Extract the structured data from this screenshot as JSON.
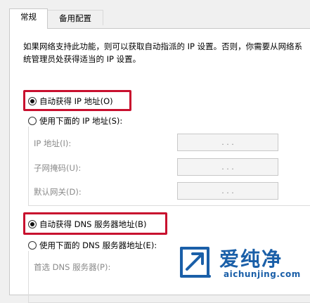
{
  "tabs": [
    {
      "label": "常规",
      "active": true
    },
    {
      "label": "备用配置",
      "active": false
    }
  ],
  "description": "如果网络支持此功能，则可以获取自动指派的 IP 设置。否则，你需要从网络系统管理员处获得适当的 IP 设置。",
  "ip": {
    "auto_label": "自动获得 IP 地址(O)",
    "auto_selected": true,
    "manual_label": "使用下面的 IP 地址(S):",
    "manual_selected": false,
    "fields": [
      {
        "label": "IP 地址(I):",
        "value": ". . ."
      },
      {
        "label": "子网掩码(U):",
        "value": ". . ."
      },
      {
        "label": "默认网关(D):",
        "value": ". . ."
      }
    ]
  },
  "dns": {
    "auto_label": "自动获得 DNS 服务器地址(B)",
    "auto_selected": true,
    "manual_label": "使用下面的 DNS 服务器地址(E):",
    "manual_selected": false,
    "fields": [
      {
        "label": "首选 DNS 服务器(P):"
      }
    ]
  },
  "watermark": {
    "name": "爱纯净",
    "url": "aichunjing.com",
    "color": "#1a5fa8"
  },
  "highlight_color": "#c8102e"
}
